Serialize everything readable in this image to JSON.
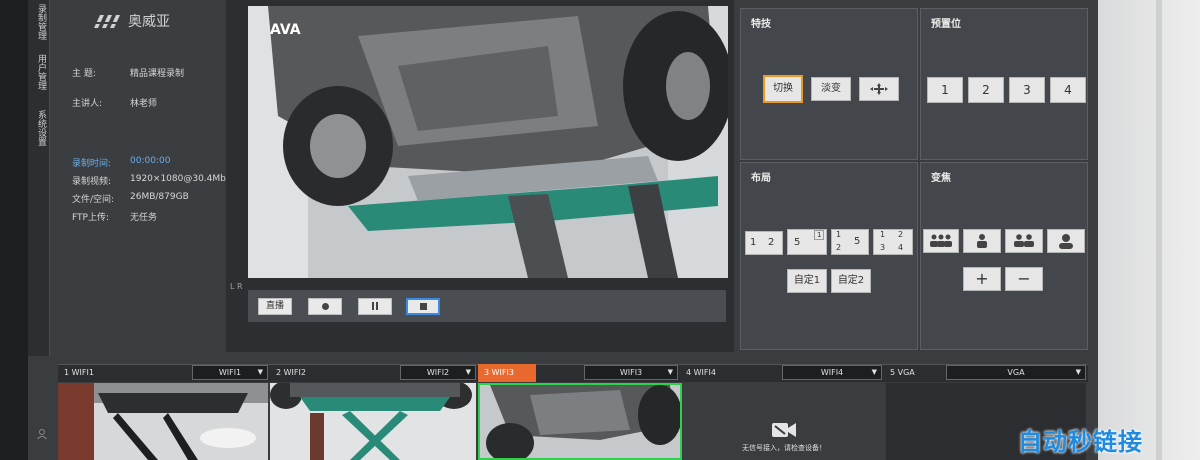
{
  "sidebar": {
    "items": [
      {
        "label": "录制管理"
      },
      {
        "label": "用户管理"
      },
      {
        "label": "系统设置"
      }
    ]
  },
  "info": {
    "logo_text": "奥威亚",
    "topic_label": "主  题:",
    "topic_value": "精品课程录制",
    "speaker_label": "主讲人:",
    "speaker_value": "林老师",
    "rec_time_label": "录制时间:",
    "rec_time_value": "00:00:00",
    "rec_video_label": "录制视频:",
    "rec_video_value": "1920×1080@30.4Mbps",
    "file_space_label": "文件/空间:",
    "file_space_value": "26MB/879GB",
    "ftp_label": "FTP上传:",
    "ftp_value": "无任务"
  },
  "preview": {
    "lr_label": "L R",
    "controls": {
      "live_label": "直播"
    }
  },
  "panels": {
    "effects": {
      "title": "特技",
      "switch_label": "切换",
      "fade_label": "淡变"
    },
    "presets": {
      "title": "预置位",
      "buttons": [
        "1",
        "2",
        "3",
        "4"
      ]
    },
    "layout": {
      "title": "布局",
      "custom1_label": "自定1",
      "custom2_label": "自定2",
      "nums": [
        "1",
        "2",
        "5",
        "1",
        "1",
        "2",
        "5",
        "1",
        "2",
        "3",
        "4"
      ]
    },
    "zoom": {
      "title": "变焦",
      "plus_label": "+",
      "minus_label": "−"
    }
  },
  "sources": [
    {
      "tab": "1 WIFI1",
      "select": "WIFI1",
      "active": false
    },
    {
      "tab": "2 WIFI2",
      "select": "WIFI2",
      "active": false
    },
    {
      "tab": "3 WIFI3",
      "select": "WIFI3",
      "active": true
    },
    {
      "tab": "4 WIFI4",
      "select": "WIFI4",
      "active": false
    },
    {
      "tab": "5 VGA",
      "select": "VGA",
      "active": false
    }
  ],
  "no_signal_message": "无信号接入，请检查设备！",
  "watermark": "自动秒链接",
  "colors": {
    "accent_orange": "#e8682e",
    "accent_blue": "#3b8be0",
    "highlight_gold": "#e79a26",
    "watermark_blue": "#1e8be0"
  }
}
